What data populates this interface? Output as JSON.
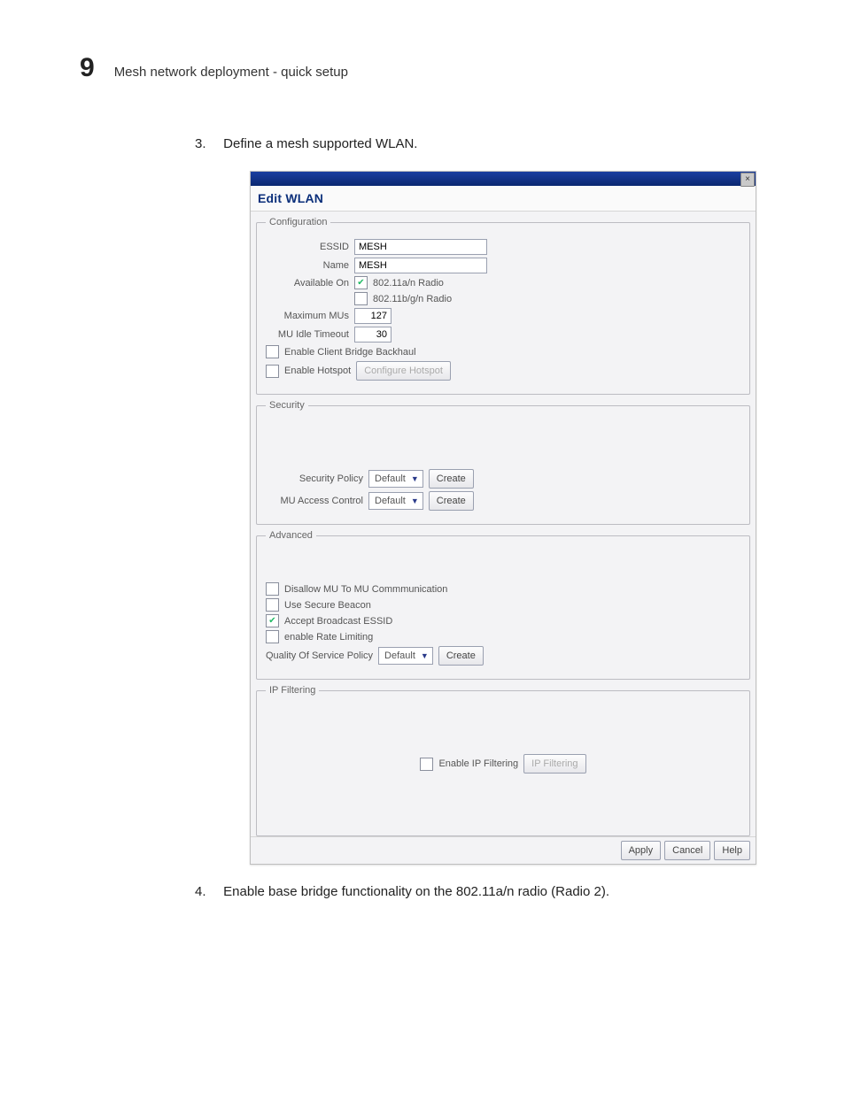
{
  "page": {
    "section_number": "9",
    "section_title": "Mesh network deployment - quick setup",
    "step3_num": "3.",
    "step3_text": "Define a mesh supported WLAN.",
    "step4_num": "4.",
    "step4_text": "Enable base bridge functionality on the 802.11a/n radio (Radio 2)."
  },
  "window": {
    "close_glyph": "×",
    "title": "Edit WLAN"
  },
  "config": {
    "legend": "Configuration",
    "essid_label": "ESSID",
    "essid_value": "MESH",
    "name_label": "Name",
    "name_value": "MESH",
    "available_on_label": "Available On",
    "radio_a_label": "802.11a/n Radio",
    "radio_a_checked": true,
    "radio_bgn_label": "802.11b/g/n Radio",
    "radio_bgn_checked": false,
    "max_mus_label": "Maximum MUs",
    "max_mus_value": "127",
    "idle_label": "MU Idle Timeout",
    "idle_value": "30",
    "enable_backhaul_label": "Enable Client Bridge Backhaul",
    "enable_backhaul_checked": false,
    "enable_hotspot_label": "Enable Hotspot",
    "enable_hotspot_checked": false,
    "configure_hotspot_btn": "Configure Hotspot"
  },
  "security": {
    "legend": "Security",
    "policy_label": "Security Policy",
    "policy_value": "Default",
    "access_label": "MU Access Control",
    "access_value": "Default",
    "create_btn": "Create"
  },
  "advanced": {
    "legend": "Advanced",
    "disallow_label": "Disallow MU To MU Commmunication",
    "secure_beacon_label": "Use Secure Beacon",
    "accept_essid_label": "Accept Broadcast ESSID",
    "accept_essid_checked": true,
    "rate_limit_label": "enable Rate Limiting",
    "qos_label": "Quality Of Service Policy",
    "qos_value": "Default",
    "create_btn": "Create"
  },
  "ipfilter": {
    "legend": "IP Filtering",
    "enable_label": "Enable IP Filtering",
    "button_label": "IP Filtering"
  },
  "footer": {
    "apply": "Apply",
    "cancel": "Cancel",
    "help": "Help"
  }
}
